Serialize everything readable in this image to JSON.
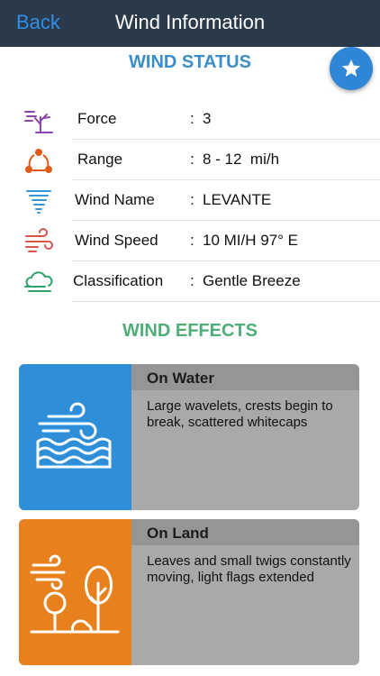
{
  "nav": {
    "back_label": "Back",
    "title": "Wind Information"
  },
  "status": {
    "title": "WIND STATUS",
    "rows": [
      {
        "icon": "tree-wind-icon",
        "label": "Force",
        "value": "3"
      },
      {
        "icon": "range-icon",
        "label": "Range",
        "value": "8 - 12  mi/h"
      },
      {
        "icon": "tornado-icon",
        "label": "Wind Name",
        "value": "LEVANTE"
      },
      {
        "icon": "wind-speed-icon",
        "label": "Wind Speed",
        "value": "10 MI/H 97° E"
      },
      {
        "icon": "cloud-wind-icon",
        "label": "Classification",
        "value": "Gentle Breeze"
      }
    ],
    "separator": ":"
  },
  "effects": {
    "title": "WIND EFFECTS",
    "cards": [
      {
        "icon": "wind-water-icon",
        "title": "On Water",
        "description": "Large wavelets, crests begin to break, scattered whitecaps",
        "color": "#2e8fd8"
      },
      {
        "icon": "wind-land-icon",
        "title": "On Land",
        "description": "Leaves and small twigs constantly moving, light flags extended",
        "color": "#e8801e"
      }
    ]
  },
  "colors": {
    "navbar": "#2b3a4b",
    "accent_blue": "#2e8fe6",
    "status_title": "#3a8dc9",
    "effects_title": "#4fae78"
  }
}
